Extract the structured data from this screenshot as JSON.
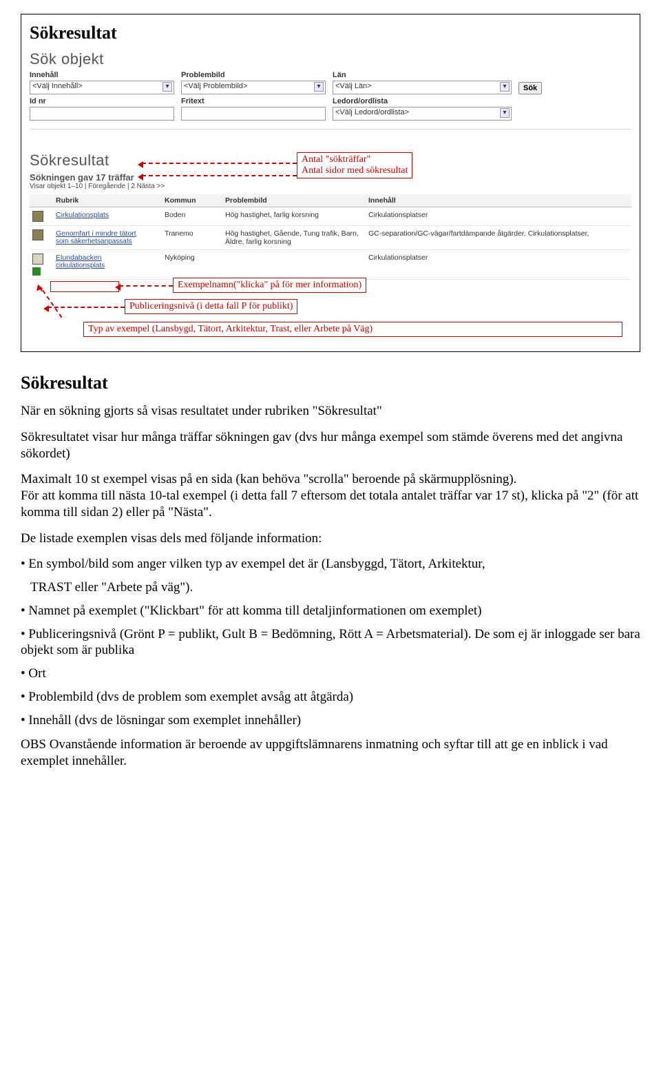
{
  "title": "Sökresultat",
  "search_panel": {
    "title": "Sök objekt",
    "labels": {
      "innehall": "Innehåll",
      "problembild": "Problembild",
      "lan": "Län",
      "idnr": "Id nr",
      "fritext": "Fritext",
      "ledord": "Ledord/ordlista"
    },
    "placeholders": {
      "innehall": "<Välj Innehåll>",
      "problembild": "<Välj Problembild>",
      "lan": "<Välj Län>",
      "ledord": "<Välj Ledord/ordlista>"
    },
    "sok_button": "Sök"
  },
  "results_panel": {
    "title": "Sökresultat",
    "summary": "Sökningen gav 17 träffar",
    "paging": "Visar objekt 1–10 | Föregående | 2 Nästa >>",
    "columns": {
      "rubrik": "Rubrik",
      "kommun": "Kommun",
      "problembild": "Problembild",
      "innehall": "Innehåll"
    },
    "rows": [
      {
        "rubrik": "Cirkulationsplats",
        "kommun": "Boden",
        "problembild": "Hög hastighet, farlig korsning",
        "innehall": "Cirkulationsplatser"
      },
      {
        "rubrik": "Genomfart i mindre tätort",
        "sublink": "som säkerhetsanpassats",
        "kommun": "Tranemo",
        "problembild": "Hög hastighet, Gående, Tung trafik, Barn, Äldre, farlig korsning",
        "innehall": "GC-separation/GC-vägar/fartdämpande åtgärder, Cirkulationsplatser,"
      },
      {
        "rubrik": "Elundabacken",
        "sublink": "cirkulationsplats",
        "kommun": "Nyköping",
        "problembild": "",
        "innehall": "Cirkulationsplatser"
      }
    ]
  },
  "callouts": {
    "hits": {
      "line1": "Antal \"sökträffar\"",
      "line2": "Antal sidor med sökresultat"
    },
    "example_name": "Exempelnamn(\"klicka\" på för mer information)",
    "publevel": "Publiceringsnivå (i detta fall P för publikt)",
    "typ": "Typ av exempel (Lansbygd, Tätort, Arkitektur, Trast, eller Arbete på Väg)"
  },
  "body": {
    "heading": "Sökresultat",
    "p1": "När en sökning gjorts så visas resultatet under rubriken \"Sökresultat\"",
    "p2": "Sökresultatet visar hur många träffar sökningen gav (dvs hur många exempel som stämde överens med det angivna sökordet)",
    "p3a": "Maximalt 10 st exempel visas på en sida (kan behöva \"scrolla\" beroende på skärmupplösning).",
    "p3b": "För att komma till nästa 10-tal exempel (i detta fall 7 eftersom det totala antalet träffar var 17 st), klicka på \"2\" (för att komma till sidan 2) eller på \"Nästa\".",
    "p4": "De listade exemplen visas dels med följande information:",
    "li1a": "• En symbol/bild som anger vilken typ av exempel det är (Lansbyggd, Tätort, Arkitektur,",
    "li1b": "TRAST eller \"Arbete på väg\").",
    "li2": "• Namnet på exemplet (\"Klickbart\" för att komma till detaljinformationen om exemplet)",
    "li3": "• Publiceringsnivå (Grönt P = publikt, Gult B = Bedömning, Rött A = Arbetsmaterial). De som ej är inloggade ser bara objekt som är publika",
    "li4": "• Ort",
    "li5": "• Problembild (dvs de problem som exemplet avsåg att åtgärda)",
    "li6": "• Innehåll (dvs de lösningar som exemplet innehåller)",
    "p5": "OBS Ovanstående information är beroende av uppgiftslämnarens inmatning och syftar till att ge en inblick i vad exemplet innehåller."
  }
}
